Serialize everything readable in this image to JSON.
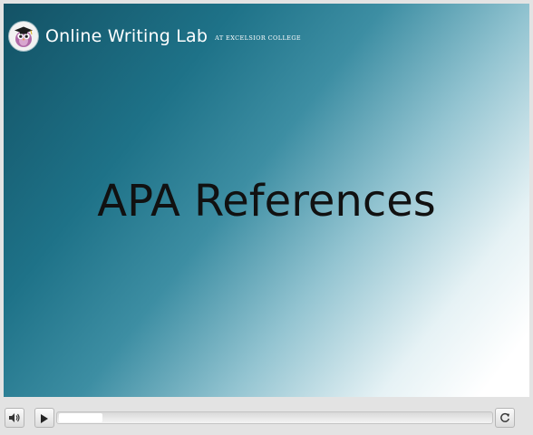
{
  "brand": {
    "title": "Online Writing Lab",
    "subtitle": "AT EXCELSIOR COLLEGE",
    "logo_icon": "owl-mascot-icon"
  },
  "slide": {
    "title": "APA References"
  },
  "controls": {
    "volume_icon": "speaker-icon",
    "play_icon": "play-icon",
    "replay_icon": "replay-icon",
    "progress_fraction": 0.1
  },
  "colors": {
    "gradient_dark": "#135265",
    "gradient_mid": "#1e7288",
    "gradient_light": "#ffffff",
    "title_text": "#111111"
  }
}
